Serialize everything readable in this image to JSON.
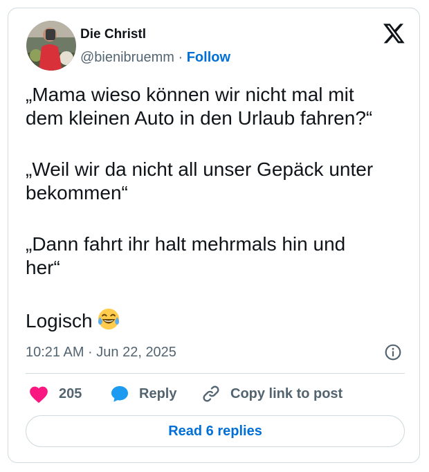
{
  "author": {
    "display_name": "Die Christl",
    "handle": "@bienibruemm",
    "separator": "·",
    "follow_label": "Follow",
    "avatar_icon": "profile-photo"
  },
  "logo_icon": "x-logo",
  "tweet": {
    "paragraphs": [
      "„Mama wieso können wir nicht mal mit\ndem kleinen Auto in den Urlaub fahren?“",
      "„Weil wir da nicht all unser Gepäck unter\nbekommen“",
      "„Dann fahrt ihr halt mehrmals hin und\nher“"
    ],
    "last_line": "Logisch",
    "emoji_icon": "face-with-tears-of-joy"
  },
  "timestamp": "10:21 AM · Jun 22, 2025",
  "info_icon": "info-circle",
  "actions": {
    "like_count": "205",
    "reply_label": "Reply",
    "copy_link_label": "Copy link to post"
  },
  "read_replies_label": "Read 6 replies",
  "colors": {
    "accent_blue": "#006fd6",
    "like_pink": "#f91880",
    "reply_blue": "#1d9bf0",
    "secondary_text": "#536471",
    "border": "#cfd9de"
  }
}
